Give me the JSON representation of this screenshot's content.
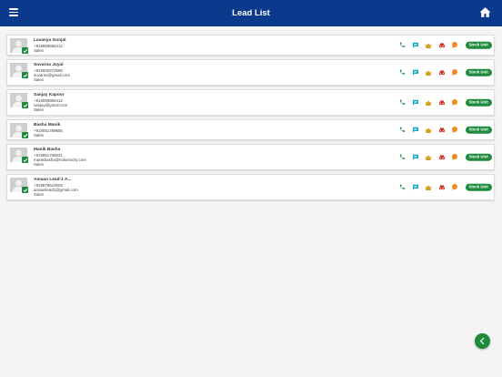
{
  "header": {
    "title": "Lead List"
  },
  "leads": [
    {
      "name": "Lavanya Gunjal",
      "lines": [
        "+918658656412",
        "Sales"
      ],
      "status": "Stock Unit"
    },
    {
      "name": "Suvarna Joyal",
      "lines": [
        "+918002572565",
        "suvarna@gmail.com",
        "Sales"
      ],
      "status": "Stock Unit"
    },
    {
      "name": "Sanjay Kapoor",
      "lines": [
        "+918050856412",
        "sanjay@gmail.com",
        "Sales"
      ],
      "status": "Stock Unit"
    },
    {
      "name": "Basha Manik",
      "lines": [
        "+918051789656",
        "Sales"
      ],
      "status": "Stock Unit"
    },
    {
      "name": "Manik Basha",
      "lines": [
        "+918951796521",
        "manikbasha@mitvelocity.com",
        "Sales"
      ],
      "status": "Stock Unit"
    },
    {
      "name": "Amaan Lead-1 A...",
      "lines": [
        "+919578610003",
        "amaanlead1@gmail.com",
        "Sales"
      ],
      "status": "Stock Unit"
    }
  ],
  "icons": {
    "menu": "hamburger-menu",
    "home": "home",
    "actions": [
      "phone",
      "chat",
      "crown",
      "car",
      "speech-bubble"
    ],
    "fab": "chevron-left"
  },
  "colors": {
    "header": "#0b3a8c",
    "accent_green": "#1e8a3c",
    "chat": "#19a7c9",
    "crown": "#d9a21b",
    "car": "#d6372d",
    "speech": "#f08a1c"
  }
}
